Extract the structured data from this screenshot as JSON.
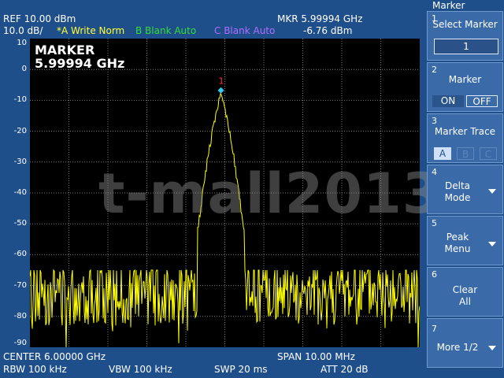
{
  "header": {
    "ref": "REF  10.00 dBm",
    "scale": "10.0 dB/",
    "trace_a": "*A Write Norm",
    "trace_b": "B Blank Auto",
    "trace_c": "C Blank Auto",
    "mkr_freq": "MKR  5.99994 GHz",
    "mkr_level": "-6.76 dBm"
  },
  "marker_display": {
    "title": "MARKER",
    "freq": "5.99994 GHz",
    "number": "1"
  },
  "watermark": "t-mall2013",
  "y_axis": {
    "labels": [
      "10",
      "0",
      "-10",
      "-20",
      "-30",
      "-40",
      "-50",
      "-60",
      "-70",
      "-80",
      "-90"
    ]
  },
  "footer": {
    "center": "CENTER 6.00000 GHz",
    "span": "SPAN 10.00 MHz",
    "rbw": "RBW  100 kHz",
    "vbw": "VBW  100 kHz",
    "swp": "SWP  20 ms",
    "att": "ATT  20 dB"
  },
  "softkeys": {
    "menu_title": "Marker",
    "select_marker": {
      "num": "1",
      "label": "Select Marker",
      "value": "1"
    },
    "marker": {
      "num": "2",
      "label": "Marker",
      "on": "ON",
      "off": "OFF"
    },
    "marker_trace": {
      "num": "3",
      "label": "Marker Trace",
      "a": "A",
      "b": "B",
      "c": "C"
    },
    "delta_mode": {
      "num": "4",
      "line1": "Delta",
      "line2": "Mode"
    },
    "peak_menu": {
      "num": "5",
      "line1": "Peak",
      "line2": "Menu"
    },
    "clear_all": {
      "num": "6",
      "line1": "Clear",
      "line2": "All"
    },
    "more": {
      "num": "7",
      "label": "More 1/2"
    }
  },
  "chart_data": {
    "type": "line",
    "trace_color": "#ffff00",
    "grid": true,
    "x_divisions": 10,
    "ylim": [
      -90,
      10
    ],
    "peak_x_fraction": 0.49,
    "peak_level": -6.76,
    "noise_floor": [
      -90,
      -65
    ]
  }
}
